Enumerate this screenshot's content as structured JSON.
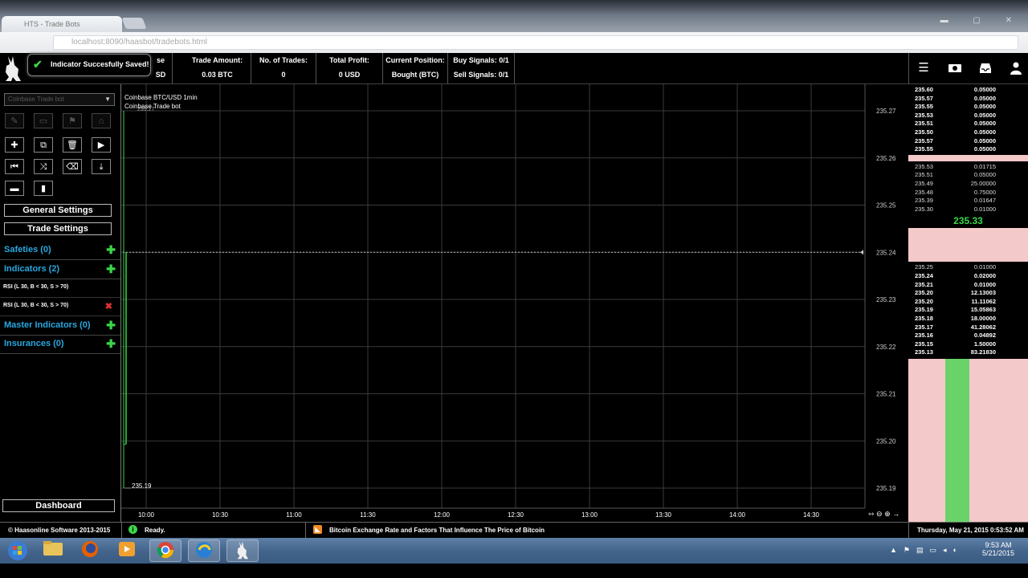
{
  "browser": {
    "tab_title": "HTS - Trade Bots",
    "url": "localhost:8090/haasbot/tradebots.html",
    "window_controls": "▬ ▢ ✕"
  },
  "toast": {
    "message": "Indicator Succesfully Saved!"
  },
  "header": {
    "cells": [
      {
        "label": "se",
        "value": "SD"
      },
      {
        "label": "Trade Amount:",
        "value": "0.03 BTC"
      },
      {
        "label": "No. of Trades:",
        "value": "0"
      },
      {
        "label": "Total Profit:",
        "value": "0 USD"
      },
      {
        "label": "Current Position:",
        "value": "Bought (BTC)"
      },
      {
        "label": "Buy Signals: 0/1",
        "value": "Sell Signals: 0/1"
      }
    ],
    "icons": [
      "menu-icon",
      "money-icon",
      "inbox-icon",
      "user-icon"
    ]
  },
  "sidebar": {
    "bot_select": "Coinbase Trade bot",
    "general_settings": "General Settings",
    "trade_settings": "Trade Settings",
    "sections": {
      "safeties": "Safeties (0)",
      "indicators": "Indicators (2)",
      "master_indicators": "Master Indicators (0)",
      "insurances": "Insurances (0)"
    },
    "indicators": [
      "RSI (L 30, B < 30, S > 70)",
      "RSI (L 30, B < 30, S > 70)"
    ],
    "dashboard": "Dashboard"
  },
  "chart_data": {
    "type": "line",
    "title": "Coinbase BTC/USD 1min",
    "subtitle": "Coinbase Trade bot",
    "x_ticks": [
      "10:00",
      "10:30",
      "11:00",
      "11:30",
      "12:00",
      "12:30",
      "13:00",
      "13:30",
      "14:00",
      "14:30"
    ],
    "y_ticks": [
      235.27,
      235.26,
      235.25,
      235.24,
      235.23,
      235.22,
      235.21,
      235.2,
      235.19
    ],
    "ylim": [
      235.19,
      235.27
    ],
    "y_labels": [
      "235.27",
      "235.26",
      "235.25",
      "235.24",
      "235.23",
      "235.22",
      "235.21",
      "235.20",
      "235.19"
    ],
    "price_start_label": "235.27",
    "price_end_label": "235.19",
    "current_price_line": 235.24,
    "grid": true,
    "nav_icons": "⇿ ⊖ ⊕ →"
  },
  "orderbook": {
    "asks": [
      [
        "235.60",
        "0.05000"
      ],
      [
        "235.57",
        "0.05000"
      ],
      [
        "235.55",
        "0.05000"
      ],
      [
        "235.53",
        "0.05000"
      ],
      [
        "235.51",
        "0.05000"
      ],
      [
        "235.50",
        "0.05000"
      ],
      [
        "235.57",
        "0.05000"
      ],
      [
        "235.55",
        "0.05000"
      ]
    ],
    "mid_asks": [
      [
        "235.53",
        "0.01715"
      ],
      [
        "235.51",
        "0.05000"
      ],
      [
        "235.49",
        "25.00000"
      ],
      [
        "235.48",
        "0.75000"
      ],
      [
        "235.39",
        "0.01647"
      ],
      [
        "235.30",
        "0.01000"
      ]
    ],
    "last_price": "235.33",
    "bids": [
      [
        "235.25",
        "0.01000"
      ],
      [
        "235.24",
        "0.02000"
      ],
      [
        "235.21",
        "0.01000"
      ],
      [
        "235.20",
        "12.13003"
      ],
      [
        "235.20",
        "11.11062"
      ],
      [
        "235.19",
        "15.05863"
      ],
      [
        "235.18",
        "18.00000"
      ],
      [
        "235.17",
        "41.28062"
      ],
      [
        "235.16",
        "0.04892"
      ],
      [
        "235.15",
        "1.50000"
      ],
      [
        "235.13",
        "83.21830"
      ]
    ]
  },
  "status": {
    "copyright": "© Haasonline Software 2013-2015",
    "state": "Ready.",
    "news": "Bitcoin Exchange Rate and Factors That Influence The Price of Bitcoin",
    "datetime": "Thursday, May 21, 2015 0:53:52 AM"
  },
  "taskbar": {
    "time": "9:53 AM",
    "date": "5/21/2015"
  },
  "colors": {
    "accent_blue": "#29a8e0",
    "green": "#3bd64a",
    "red": "#e03030",
    "ask_bg": "#f4c9c9"
  }
}
